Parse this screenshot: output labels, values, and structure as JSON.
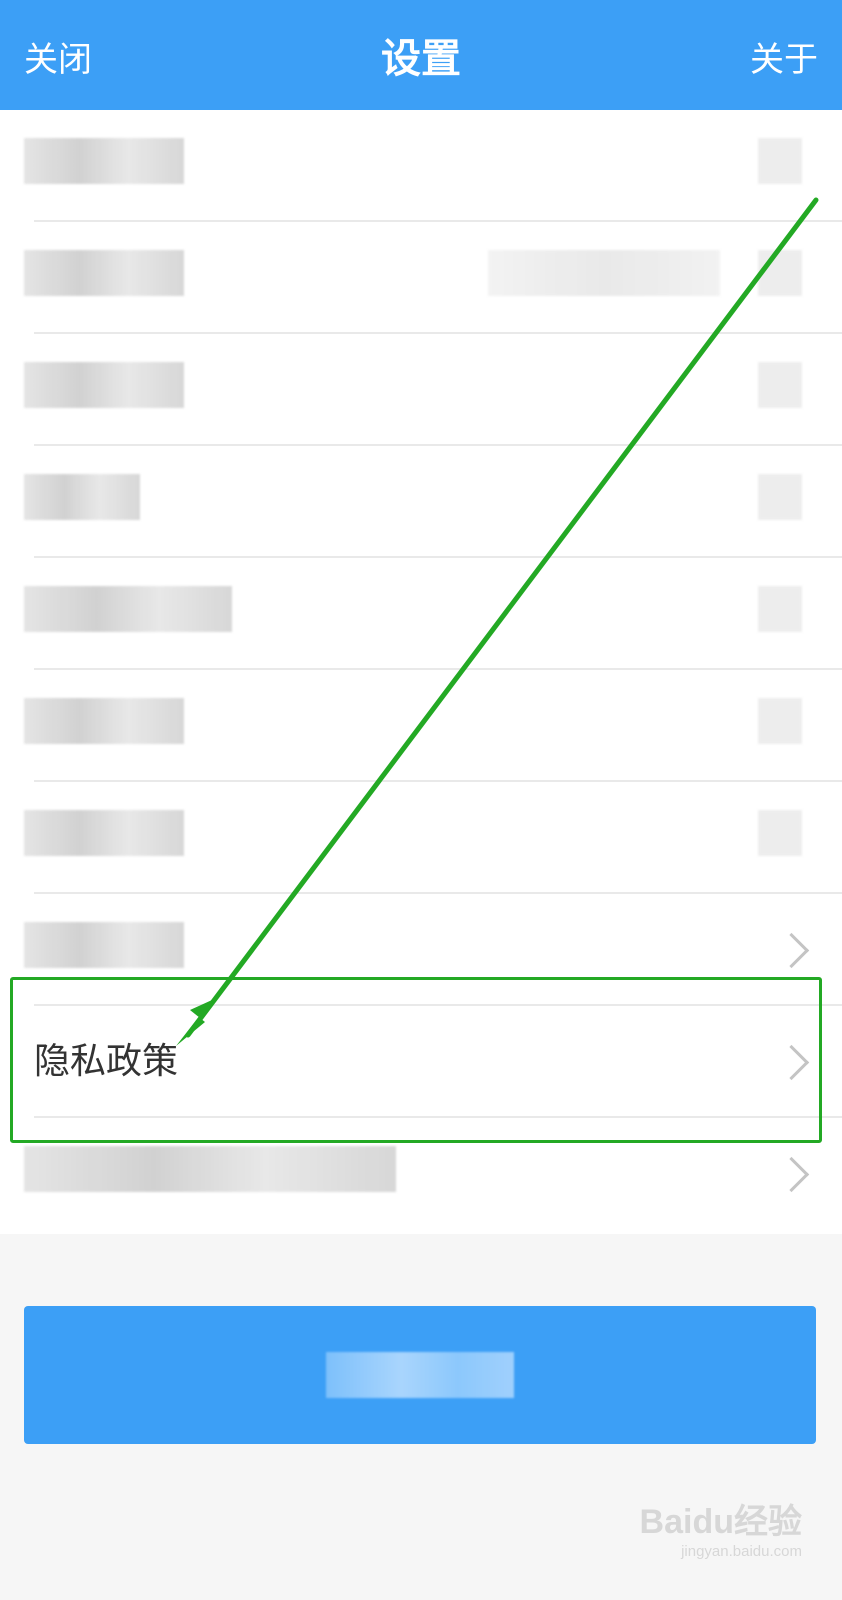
{
  "nav": {
    "close_label": "关闭",
    "title": "设置",
    "about_label": "关于"
  },
  "privacy_item": {
    "label": "隐私政策"
  },
  "colors": {
    "accent": "#3c9ff6",
    "highlight": "#23a924"
  },
  "watermark": {
    "brand": "Baidu经验",
    "url": "jingyan.baidu.com"
  }
}
